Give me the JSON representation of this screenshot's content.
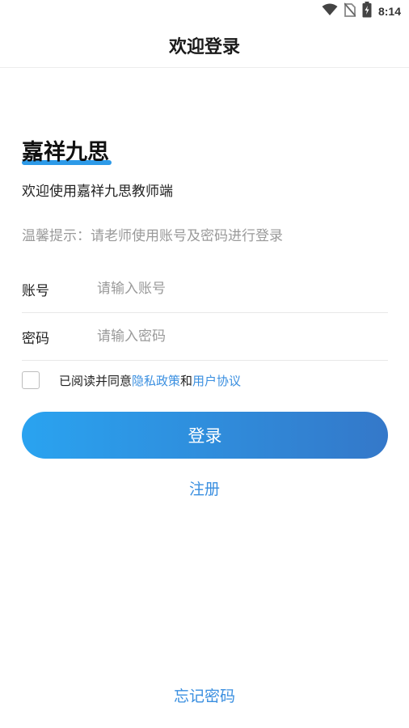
{
  "status_bar": {
    "time": "8:14",
    "icons": [
      "wifi-icon",
      "no-sim-icon",
      "battery-icon"
    ]
  },
  "header": {
    "title": "欢迎登录"
  },
  "brand": {
    "name": "嘉祥九思",
    "accent_color": "#2d9ae8"
  },
  "welcome_text": "欢迎使用嘉祥九思教师端",
  "hint_text": "温馨提示：请老师使用账号及密码进行登录",
  "form": {
    "account": {
      "label": "账号",
      "placeholder": "请输入账号",
      "value": ""
    },
    "password": {
      "label": "密码",
      "placeholder": "请输入密码",
      "value": ""
    }
  },
  "agreement": {
    "checked": false,
    "prefix": "已阅读并同意",
    "privacy_link": "隐私政策",
    "conjunction": "和",
    "terms_link": "用户协议"
  },
  "buttons": {
    "login": "登录",
    "register": "注册",
    "forgot_password": "忘记密码"
  },
  "colors": {
    "link": "#3a8fe0",
    "button_gradient_start": "#2aa3f0",
    "button_gradient_end": "#3478c9"
  }
}
